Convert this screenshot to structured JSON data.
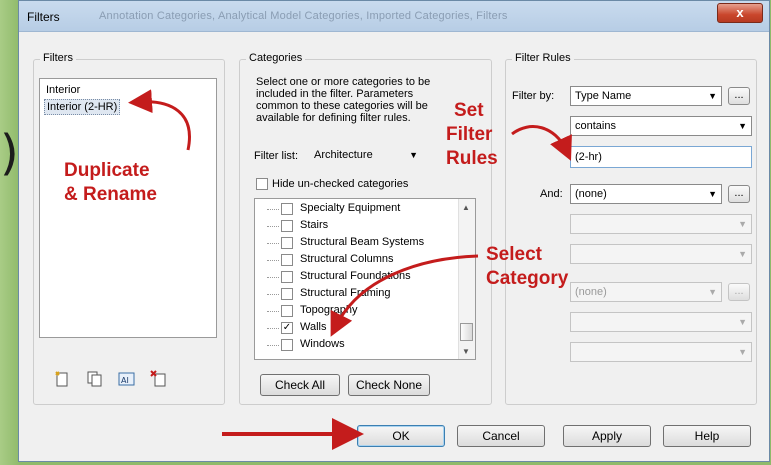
{
  "window": {
    "title": "Filters",
    "ghost_title": "Annotation Categories, Analytical Model Categories, Imported Categories, Filters",
    "close_label": "x"
  },
  "filters_group": {
    "label": "Filters",
    "items": [
      "Interior",
      "Interior (2-HR)"
    ],
    "selected_index": 1,
    "icons": [
      "new-filter-icon",
      "duplicate-filter-icon",
      "rename-filter-icon",
      "delete-filter-icon"
    ]
  },
  "categories_group": {
    "label": "Categories",
    "instructions": [
      "Select one or more categories to be",
      "included in the filter.  Parameters",
      "common to these categories will be",
      "available for defining filter rules."
    ],
    "filter_list_label": "Filter list:",
    "filter_list_value": "Architecture",
    "hide_label": "Hide un-checked categories",
    "hide_checked": false,
    "tree": [
      {
        "label": "Specialty Equipment",
        "checked": false
      },
      {
        "label": "Stairs",
        "checked": false
      },
      {
        "label": "Structural Beam Systems",
        "checked": false
      },
      {
        "label": "Structural Columns",
        "checked": false
      },
      {
        "label": "Structural Foundations",
        "checked": false
      },
      {
        "label": "Structural Framing",
        "checked": false
      },
      {
        "label": "Topography",
        "checked": false
      },
      {
        "label": "Walls",
        "checked": true
      },
      {
        "label": "Windows",
        "checked": false
      }
    ],
    "check_all": "Check All",
    "check_none": "Check None"
  },
  "rules_group": {
    "label": "Filter Rules",
    "filter_by_label": "Filter by:",
    "filter_by_value": "Type Name",
    "operator_value": "contains",
    "value_input": "(2-hr)",
    "and_label": "And:",
    "and_value": "(none)",
    "and2_value": "(none)",
    "more_label": "..."
  },
  "footer": {
    "ok": "OK",
    "cancel": "Cancel",
    "apply": "Apply",
    "help": "Help"
  },
  "annotations": {
    "duplicate_line1": "Duplicate",
    "duplicate_line2": "& Rename",
    "set_line1": "Set",
    "set_line2": "Filter",
    "set_line3": "Rules",
    "select_line1": "Select",
    "select_line2": "Category"
  },
  "colors": {
    "annotation": "#c41c1c",
    "background": "#8fba6a"
  }
}
